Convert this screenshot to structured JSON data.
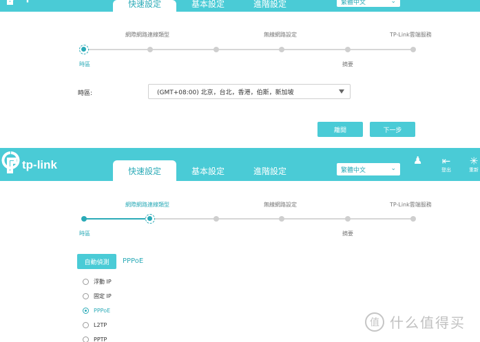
{
  "colors": {
    "brand": "#4acbd6",
    "accent": "#2aaab7",
    "track": "#d6d6d6"
  },
  "header": {
    "logo_text": "tp-link",
    "tabs": [
      {
        "label": "快速設定",
        "active": true
      },
      {
        "label": "基本設定",
        "active": false
      },
      {
        "label": "進階設定",
        "active": false
      }
    ],
    "language": "繁體中文",
    "icons": [
      {
        "name": "notification-icon",
        "label": ""
      },
      {
        "name": "logout-icon",
        "label": "登出"
      },
      {
        "name": "reboot-icon",
        "label": "重新"
      }
    ]
  },
  "wizard": {
    "top_steps": [
      "網際網路連線類型",
      "無線網路設定",
      "TP-Link雲端服務"
    ],
    "bottom_steps": [
      "時區",
      "摘要"
    ]
  },
  "timezone_screen": {
    "field_label": "時區:",
    "timezone_value": "(GMT+08:00) 北京，台北，香港，伯斯，新加坡",
    "exit_label": "離開",
    "next_label": "下一步"
  },
  "connection_screen": {
    "auto_detect_label": "自動偵測",
    "detected_type": "PPPoE",
    "options": [
      {
        "label": "浮動 IP",
        "selected": false
      },
      {
        "label": "固定 IP",
        "selected": false
      },
      {
        "label": "PPPoE",
        "selected": true
      },
      {
        "label": "L2TP",
        "selected": false
      },
      {
        "label": "PPTP",
        "selected": false
      }
    ]
  },
  "watermark": {
    "badge": "值",
    "text": "什么值得买"
  }
}
